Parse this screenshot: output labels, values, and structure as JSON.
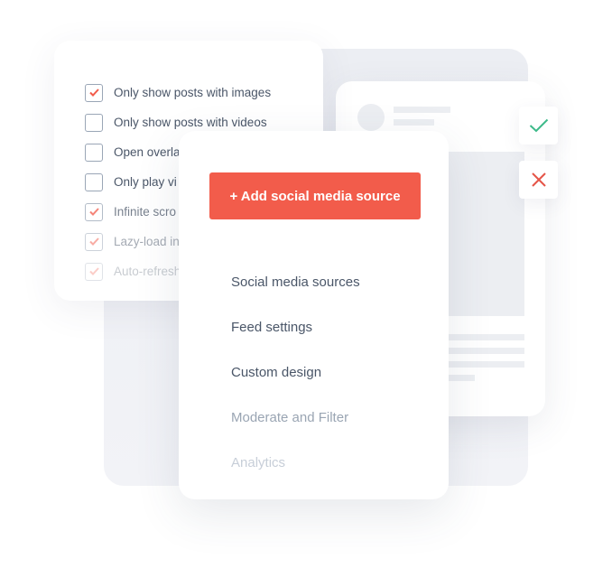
{
  "checklist": {
    "items": [
      {
        "label": "Only show posts with images",
        "checked": true,
        "opacity": 1
      },
      {
        "label": "Only show posts with videos",
        "checked": false,
        "opacity": 1
      },
      {
        "label": "Open overla",
        "checked": false,
        "opacity": 1
      },
      {
        "label": "Only play vi",
        "checked": false,
        "opacity": 1
      },
      {
        "label": "Infinite scro",
        "checked": true,
        "opacity": 0.75
      },
      {
        "label": "Lazy-load in",
        "checked": true,
        "opacity": 0.5
      },
      {
        "label": "Auto-refresh",
        "checked": true,
        "opacity": 0.3
      }
    ]
  },
  "menu": {
    "add_button_label": "+ Add social media source",
    "items": [
      {
        "label": "Social media sources",
        "color": "#4a5668"
      },
      {
        "label": "Feed settings",
        "color": "#4a5668"
      },
      {
        "label": "Custom design",
        "color": "#4a5668"
      },
      {
        "label": "Moderate and Filter",
        "color": "#9aa5b3"
      },
      {
        "label": "Analytics",
        "color": "#c7ced8"
      }
    ]
  },
  "moderation": {
    "approve_icon": "check-icon",
    "reject_icon": "close-icon"
  },
  "colors": {
    "accent": "#f25c4b",
    "approve": "#3dba8a",
    "reject": "#e55548"
  }
}
